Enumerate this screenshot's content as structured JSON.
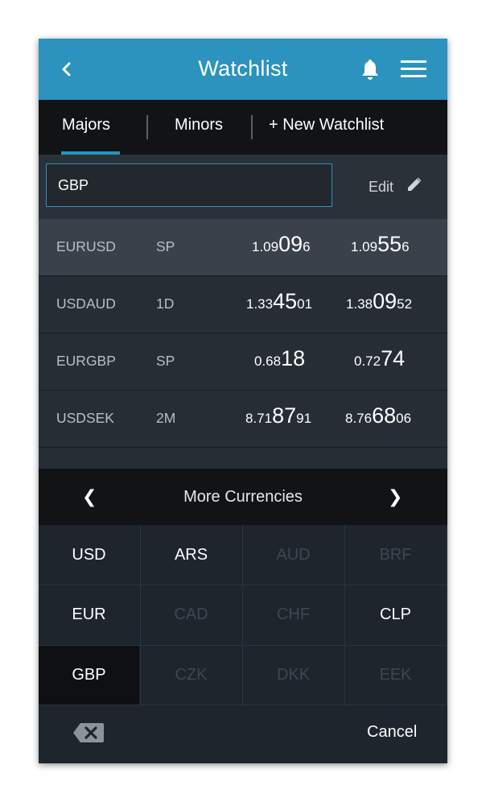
{
  "header": {
    "title": "Watchlist"
  },
  "tabs": [
    {
      "label": "Majors"
    },
    {
      "label": "Minors"
    },
    {
      "label": "+ New Watchlist"
    }
  ],
  "search": {
    "value": "GBP",
    "edit_label": "Edit"
  },
  "rows": [
    {
      "symbol": "EURUSD",
      "tenor": "SP",
      "bid": {
        "pre": "1.09",
        "big": "09",
        "post": "6"
      },
      "ask": {
        "pre": "1.09",
        "big": "55",
        "post": "6"
      }
    },
    {
      "symbol": "USDAUD",
      "tenor": "1D",
      "bid": {
        "pre": "1.33",
        "big": "45",
        "post": "01"
      },
      "ask": {
        "pre": "1.38",
        "big": "09",
        "post": "52"
      }
    },
    {
      "symbol": "EURGBP",
      "tenor": "SP",
      "bid": {
        "pre": "0.68",
        "big": "18",
        "post": ""
      },
      "ask": {
        "pre": "0.72",
        "big": "74",
        "post": ""
      }
    },
    {
      "symbol": "USDSEK",
      "tenor": "2M",
      "bid": {
        "pre": "8.71",
        "big": "87",
        "post": "91"
      },
      "ask": {
        "pre": "8.76",
        "big": "68",
        "post": "06"
      }
    }
  ],
  "keypad": {
    "title": "More Currencies",
    "prev": "❮",
    "next": "❯",
    "currencies": [
      {
        "code": "USD",
        "state": "enabled"
      },
      {
        "code": "ARS",
        "state": "enabled"
      },
      {
        "code": "AUD",
        "state": "disabled"
      },
      {
        "code": "BRF",
        "state": "disabled"
      },
      {
        "code": "EUR",
        "state": "enabled"
      },
      {
        "code": "CAD",
        "state": "disabled"
      },
      {
        "code": "CHF",
        "state": "disabled"
      },
      {
        "code": "CLP",
        "state": "enabled"
      },
      {
        "code": "GBP",
        "state": "selected"
      },
      {
        "code": "CZK",
        "state": "disabled"
      },
      {
        "code": "DKK",
        "state": "disabled"
      },
      {
        "code": "EEK",
        "state": "disabled"
      }
    ],
    "cancel_label": "Cancel"
  },
  "colors": {
    "accent": "#2b93bd",
    "background": "#1e252d"
  },
  "icons": [
    "back-icon",
    "bell-icon",
    "menu-icon",
    "pencil-icon",
    "backspace-icon"
  ]
}
